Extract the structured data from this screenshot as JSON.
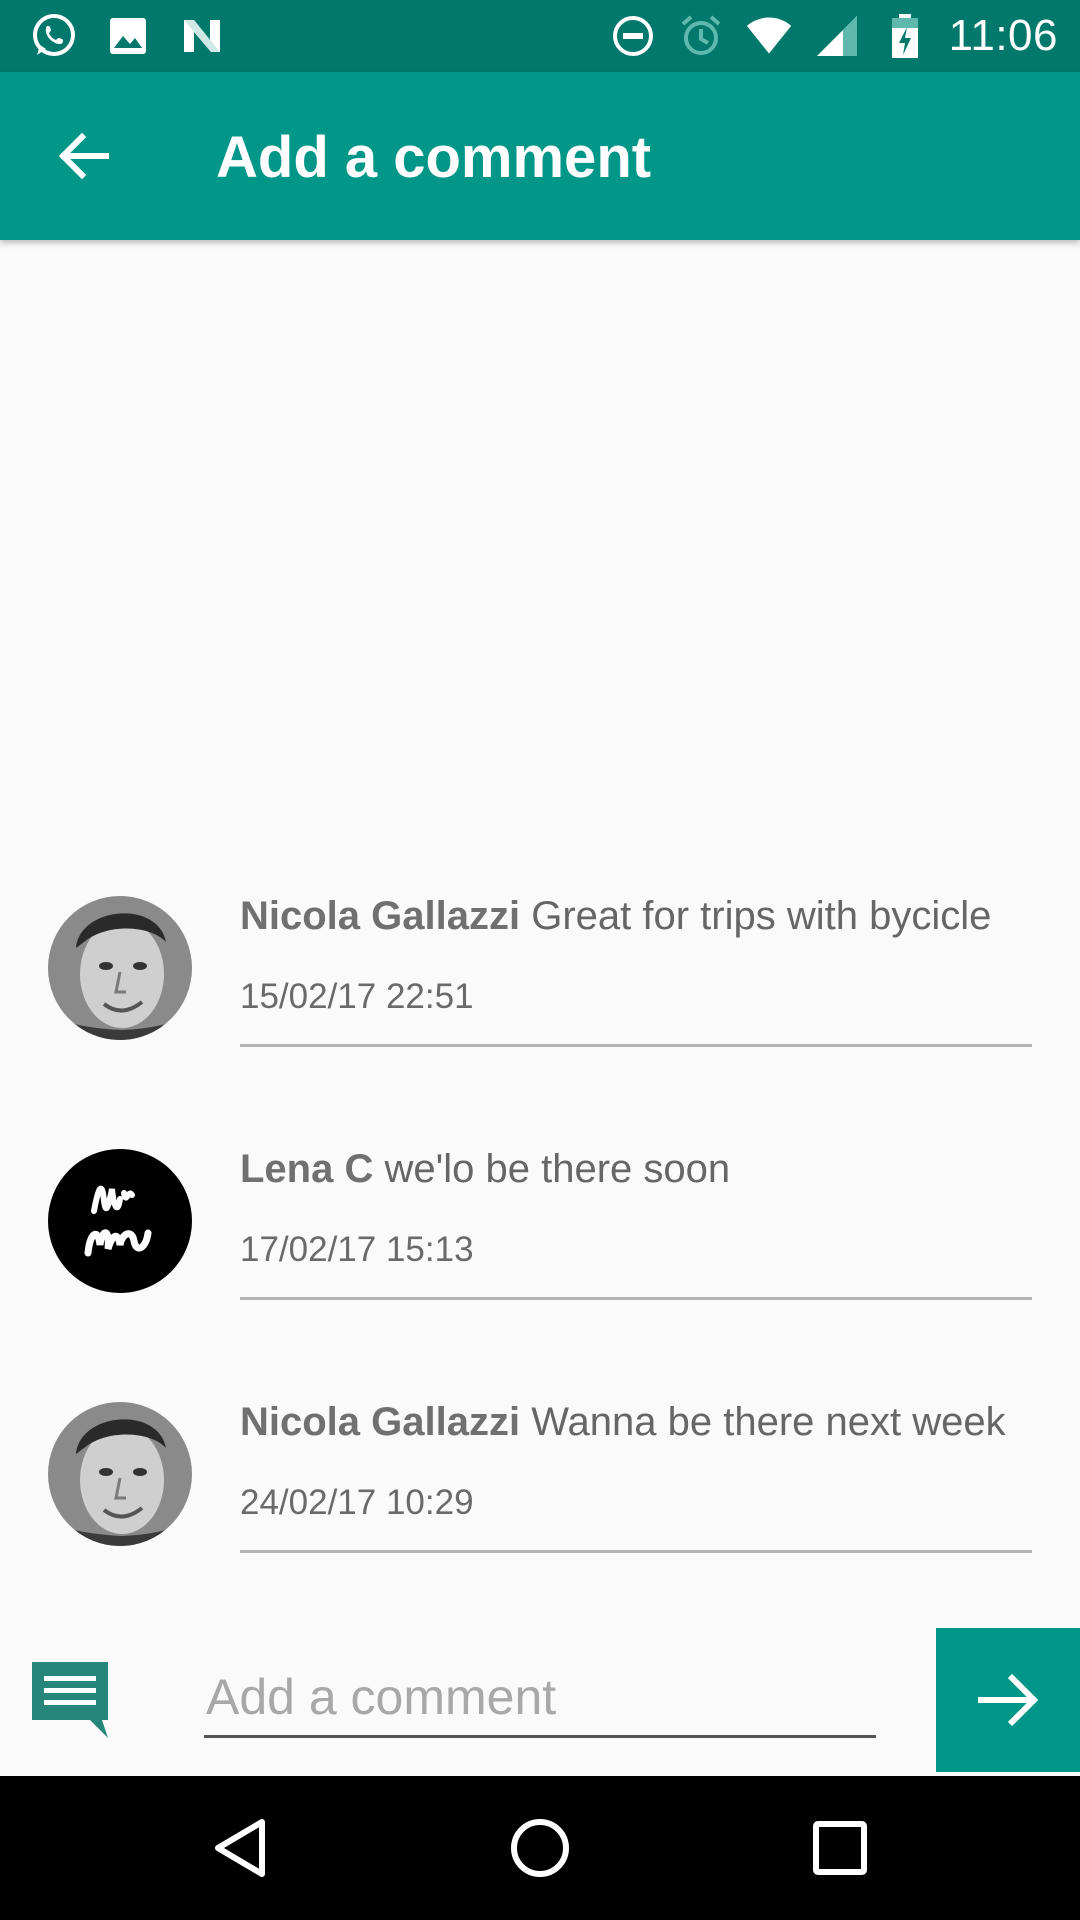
{
  "status_bar": {
    "time": "11:06",
    "left_icons": [
      "whatsapp-icon",
      "image-icon",
      "n-icon"
    ],
    "right_icons": [
      "do-not-disturb-icon",
      "alarm-icon",
      "wifi-icon",
      "signal-icon",
      "battery-icon"
    ]
  },
  "app_bar": {
    "title": "Add a comment",
    "back_icon": "arrow-back-icon",
    "color": "#009688"
  },
  "comments": [
    {
      "author": "Nicola Gallazzi",
      "text": "Great for trips with bycicle",
      "timestamp": "15/02/17 22:51",
      "avatar": "face"
    },
    {
      "author": "Lena C",
      "text": "we'lo be there soon",
      "timestamp": "17/02/17 15:13",
      "avatar": "logo"
    },
    {
      "author": "Nicola Gallazzi",
      "text": "Wanna be there next week",
      "timestamp": "24/02/17 10:29",
      "avatar": "face"
    }
  ],
  "input": {
    "placeholder": "Add a comment",
    "value": "",
    "send_icon": "arrow-forward-icon",
    "comment_icon": "comment-icon"
  },
  "nav_bar": {
    "icons": [
      "back-triangle-icon",
      "home-circle-icon",
      "recents-square-icon"
    ]
  },
  "colors": {
    "status_bar": "#00786b",
    "accent": "#009688",
    "background": "#fafafa"
  }
}
